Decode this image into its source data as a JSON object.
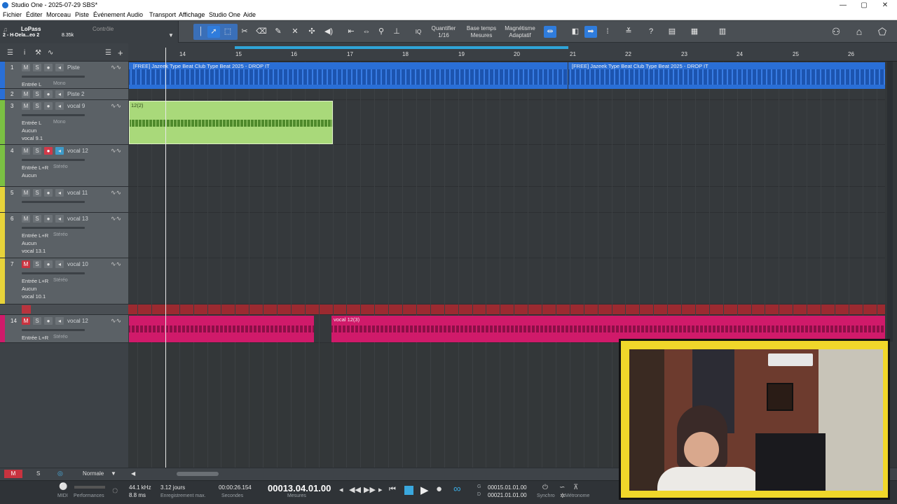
{
  "window": {
    "title": "Studio One - 2025-07-29 SBS*",
    "minimize": "—",
    "restore": "▢",
    "close": "✕"
  },
  "menu": [
    "Fichier",
    "Éditer",
    "Morceau",
    "Piste",
    "Événement",
    "Audio",
    "Transport",
    "Affichage",
    "Studio One",
    "Aide"
  ],
  "song": {
    "name": "LoPass",
    "sub": "2 - H-Dela...eo 2",
    "size": "8.35k",
    "control": "Contrôle"
  },
  "toolbar": {
    "quantize_label": "Quantifier",
    "quantize_value": "1/16",
    "timebase_label": "Base temps",
    "timebase_value": "Mesures",
    "snap_label": "Magnétisme",
    "snap_value": "Adaptatif",
    "iq": "IQ"
  },
  "ruler": {
    "bars": [
      "14",
      "15",
      "16",
      "17",
      "18",
      "19",
      "20",
      "21",
      "22",
      "23",
      "24",
      "25",
      "26"
    ]
  },
  "tracks": [
    {
      "num": "1",
      "name": "Piste",
      "input": "Entrée L",
      "mode": "Mono",
      "color": "#2a6fd6"
    },
    {
      "num": "2",
      "name": "Piste 2",
      "color": "#2a6fd6"
    },
    {
      "num": "3",
      "name": "vocal 9",
      "input": "Entrée L",
      "mode": "Mono",
      "send": "Aucun",
      "playlist": "vocal 9.1",
      "color": "#7bc043"
    },
    {
      "num": "4",
      "name": "vocal 12",
      "input": "Entrée L+R",
      "mode": "Stéréo",
      "send": "Aucun",
      "color": "#7bc043"
    },
    {
      "num": "5",
      "name": "vocal 11",
      "color": "#e8d33a"
    },
    {
      "num": "6",
      "name": "vocal 13",
      "input": "Entrée L+R",
      "mode": "Stéréo",
      "send": "Aucun",
      "playlist": "vocal 13.1",
      "color": "#e8d33a"
    },
    {
      "num": "7",
      "name": "vocal 10",
      "input": "Entrée L+R",
      "mode": "Stéréo",
      "send": "Aucun",
      "playlist": "vocal 10.1",
      "color": "#e8d33a"
    },
    {
      "num": "14",
      "name": "vocal 12",
      "input": "Entrée L+R",
      "mode": "Stéréo",
      "color": "#d01a6a"
    }
  ],
  "buttons": {
    "m": "M",
    "s": "S"
  },
  "clips": {
    "beat_a": "[FREE] Jazeek Type Beat  Club Type Beat 2025 - DROP IT",
    "beat_b": "[FREE] Jazeek Type Beat  Club Type Beat 2025 - DROP IT",
    "vocal9": "12(2)",
    "vocal12": "vocal 12(3)"
  },
  "bottombar": {
    "m": "M",
    "s": "S",
    "mode": "Normale"
  },
  "transport": {
    "midi": "MIDI",
    "performance": "Performances",
    "samplerate": "44.1 kHz",
    "latency": "8.8 ms",
    "rec_days": "3.12 jours",
    "rec_label": "Enregistrement max.",
    "seconds_value": "00:00:26.154",
    "seconds_label": "Secondes",
    "bars_value": "00013.04.01.00",
    "bars_label": "Mesures",
    "loop_start": "00015.01.01.00",
    "loop_end": "00021.01.01.00",
    "loop_start_lbl": "G",
    "loop_end_lbl": "D",
    "sync": "Synchro",
    "metronome": "Métronome"
  },
  "colors": {
    "accent": "#2f7cdc",
    "track_blue": "#2a6fd6",
    "track_green": "#7bc043",
    "track_yellow": "#e8d33a",
    "track_pink": "#d01a6a"
  }
}
